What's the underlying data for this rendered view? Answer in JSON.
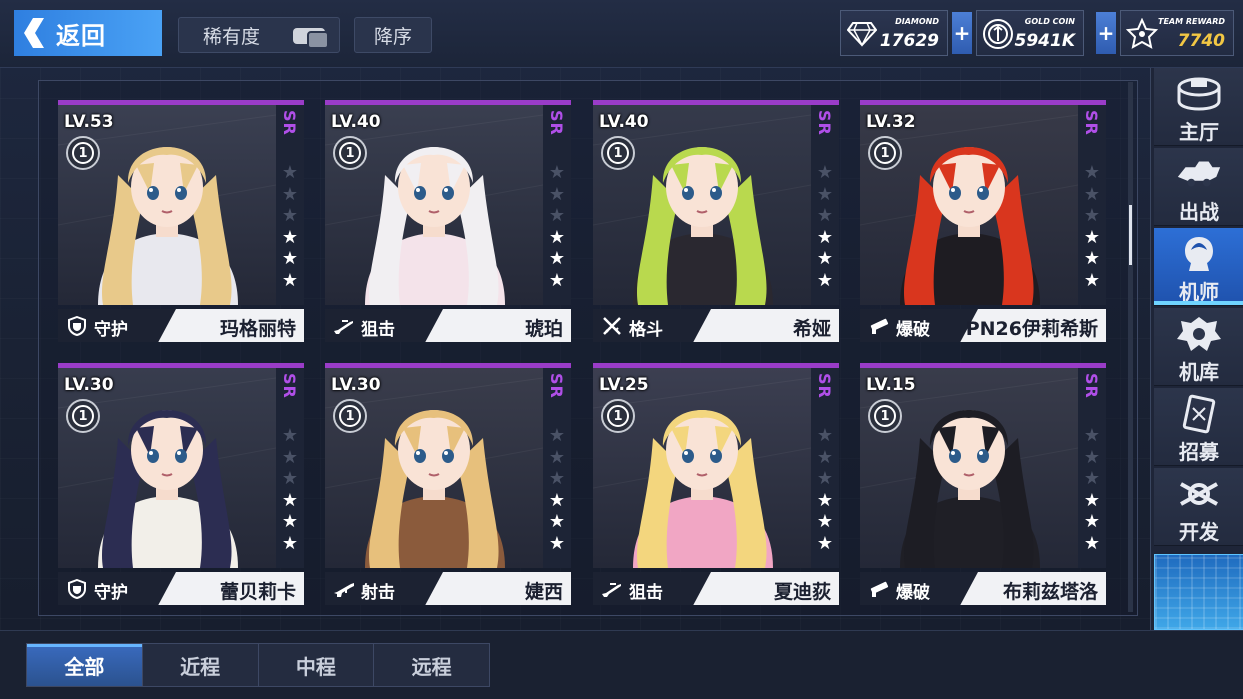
{
  "header": {
    "back_label": "返回",
    "sort_rarity_label": "稀有度",
    "sort_order_label": "降序",
    "currencies": [
      {
        "label": "DIAMOND",
        "value": "17629",
        "icon": "diamond-icon"
      },
      {
        "label": "GOLD COIN",
        "value": "5941K",
        "icon": "gold-coin-icon"
      },
      {
        "label": "TEAM REWARD",
        "value": "7740",
        "icon": "team-reward-icon"
      }
    ],
    "plus_label": "+"
  },
  "cards": [
    {
      "level": "LV.53",
      "rank": "1",
      "rarity": "SR",
      "stars": 3,
      "max_stars": 6,
      "role": "守护",
      "role_icon": "shield-icon",
      "name": "玛格丽特",
      "hair": "#e8c98a",
      "bg": "#3b4052",
      "outfit": "#e8e8ee"
    },
    {
      "level": "LV.40",
      "rank": "1",
      "rarity": "SR",
      "stars": 3,
      "max_stars": 6,
      "role": "狙击",
      "role_icon": "sniper-rifle-icon",
      "name": "琥珀",
      "hair": "#f1eff2",
      "bg": "#3a3f50",
      "outfit": "#f4e3ea"
    },
    {
      "level": "LV.40",
      "rank": "1",
      "rarity": "SR",
      "stars": 3,
      "max_stars": 6,
      "role": "格斗",
      "role_icon": "crossed-swords-icon",
      "name": "希娅",
      "hair": "#b9d94e",
      "bg": "#353a4b",
      "outfit": "#2a2830"
    },
    {
      "level": "LV.32",
      "rank": "1",
      "rarity": "SR",
      "stars": 3,
      "max_stars": 6,
      "role": "爆破",
      "role_icon": "launcher-icon",
      "name": "PN26伊莉希斯",
      "hair": "#d9361e",
      "bg": "#383a48",
      "outfit": "#1e1c22"
    },
    {
      "level": "LV.30",
      "rank": "1",
      "rarity": "SR",
      "stars": 3,
      "max_stars": 6,
      "role": "守护",
      "role_icon": "shield-icon",
      "name": "蕾贝莉卡",
      "hair": "#2c2d52",
      "bg": "#383d4e",
      "outfit": "#f2efe9"
    },
    {
      "level": "LV.30",
      "rank": "1",
      "rarity": "SR",
      "stars": 3,
      "max_stars": 6,
      "role": "射击",
      "role_icon": "rifle-icon",
      "name": "婕西",
      "hair": "#e7c07c",
      "bg": "#3a3d4c",
      "outfit": "#8b5b3c"
    },
    {
      "level": "LV.25",
      "rank": "1",
      "rarity": "SR",
      "stars": 3,
      "max_stars": 6,
      "role": "狙击",
      "role_icon": "sniper-rifle-icon",
      "name": "夏迪荻",
      "hair": "#f3d67e",
      "bg": "#3c3f51",
      "outfit": "#f1a6c4"
    },
    {
      "level": "LV.15",
      "rank": "1",
      "rarity": "SR",
      "stars": 3,
      "max_stars": 6,
      "role": "爆破",
      "role_icon": "launcher-icon",
      "name": "布莉兹塔洛",
      "hair": "#1d1d24",
      "bg": "#393c4b",
      "outfit": "#1f1f26"
    }
  ],
  "sidebar": {
    "items": [
      {
        "label": "主厅",
        "icon": "hall-icon"
      },
      {
        "label": "出战",
        "icon": "battle-icon"
      },
      {
        "label": "机师",
        "icon": "pilot-icon",
        "active": true
      },
      {
        "label": "机库",
        "icon": "hangar-icon"
      },
      {
        "label": "招募",
        "icon": "recruit-icon"
      },
      {
        "label": "开发",
        "icon": "develop-icon"
      }
    ]
  },
  "tabs": [
    {
      "label": "全部",
      "active": true
    },
    {
      "label": "近程"
    },
    {
      "label": "中程"
    },
    {
      "label": "远程"
    }
  ]
}
